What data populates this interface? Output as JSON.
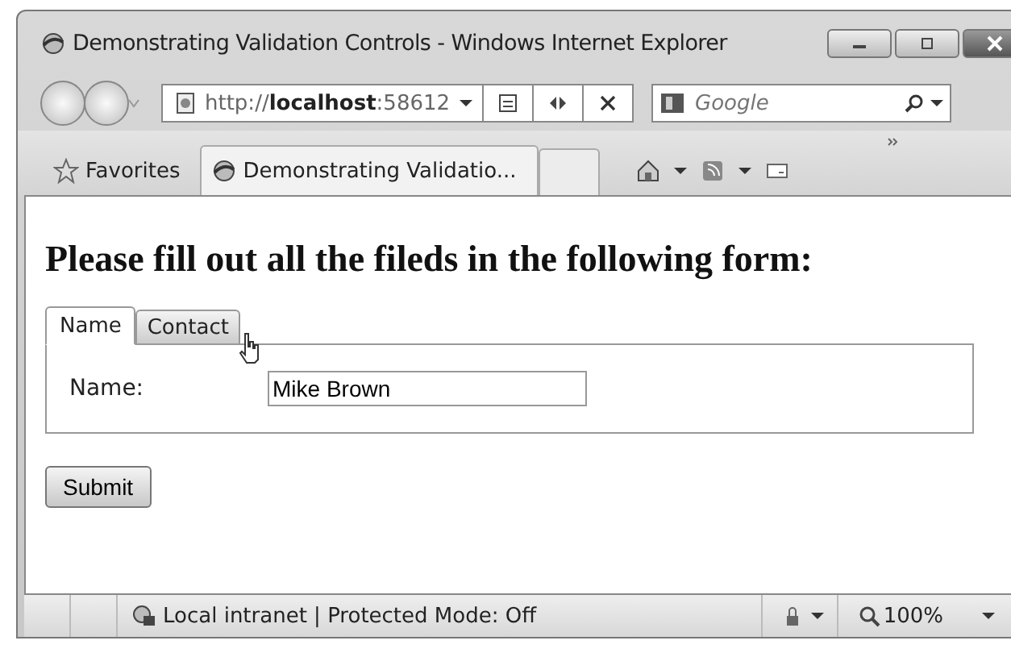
{
  "window": {
    "title": "Demonstrating Validation Controls - Windows Internet Explorer"
  },
  "address_bar": {
    "value": "http://**localhost**:58612"
  },
  "search": {
    "placeholder": "Google"
  },
  "favorites_bar": {
    "label": "Favorites",
    "tabs": [
      {
        "label": "Demonstrating Validatio...",
        "selected": true
      }
    ]
  },
  "page": {
    "heading": "Please fill out all the fileds in the following form:",
    "tabs": [
      {
        "label": "Name",
        "selected": true
      },
      {
        "label": "Contact",
        "selected": false
      }
    ],
    "field": {
      "label": "Name:",
      "value": "Mike Brown"
    },
    "submit": "Submit"
  },
  "status_bar": {
    "zone": "Local intranet | Protected Mode: Off",
    "zoom": "100%"
  }
}
